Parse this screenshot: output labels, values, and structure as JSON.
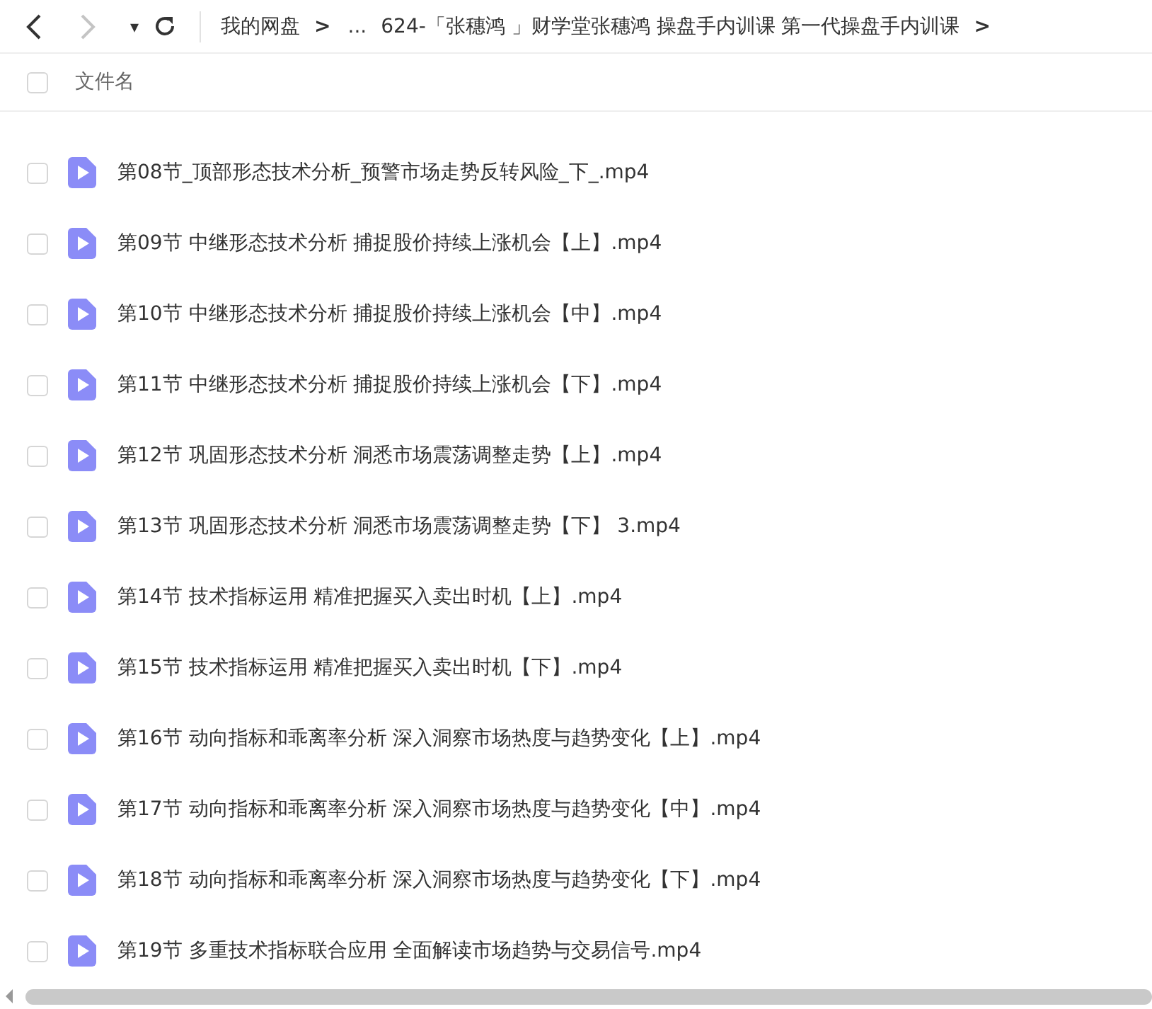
{
  "toolbar": {
    "back": {
      "disabled": false
    },
    "forward": {
      "disabled": true
    },
    "dropdown": "▾"
  },
  "breadcrumb": [
    {
      "kind": "crumb",
      "text": "我的网盘"
    },
    {
      "kind": "sep",
      "text": ">"
    },
    {
      "kind": "crumb",
      "text": "..."
    },
    {
      "kind": "crumb",
      "text": "624-「张穗鸿 」财学堂张穗鸿 操盘手内训课 第一代操盘手内训课"
    },
    {
      "kind": "sep",
      "text": ">"
    }
  ],
  "header": {
    "checked": false,
    "label": "文件名"
  },
  "files": [
    {
      "name": "第08节_顶部形态技术分析_预警市场走势反转风险_下_.mp4",
      "checked": false
    },
    {
      "name": "第09节 中继形态技术分析 捕捉股价持续上涨机会【上】.mp4",
      "checked": false
    },
    {
      "name": "第10节 中继形态技术分析 捕捉股价持续上涨机会【中】.mp4",
      "checked": false
    },
    {
      "name": "第11节 中继形态技术分析 捕捉股价持续上涨机会【下】.mp4",
      "checked": false
    },
    {
      "name": "第12节 巩固形态技术分析 洞悉市场震荡调整走势【上】.mp4",
      "checked": false
    },
    {
      "name": "第13节 巩固形态技术分析 洞悉市场震荡调整走势【下】 3.mp4",
      "checked": false
    },
    {
      "name": "第14节 技术指标运用 精准把握买入卖出时机【上】.mp4",
      "checked": false
    },
    {
      "name": "第15节 技术指标运用 精准把握买入卖出时机【下】.mp4",
      "checked": false
    },
    {
      "name": "第16节 动向指标和乖离率分析 深入洞察市场热度与趋势变化【上】.mp4",
      "checked": false
    },
    {
      "name": "第17节 动向指标和乖离率分析 深入洞察市场热度与趋势变化【中】.mp4",
      "checked": false
    },
    {
      "name": "第18节 动向指标和乖离率分析 深入洞察市场热度与趋势变化【下】.mp4",
      "checked": false
    },
    {
      "name": "第19节 多重技术指标联合应用 全面解读市场趋势与交易信号.mp4",
      "checked": false
    }
  ]
}
